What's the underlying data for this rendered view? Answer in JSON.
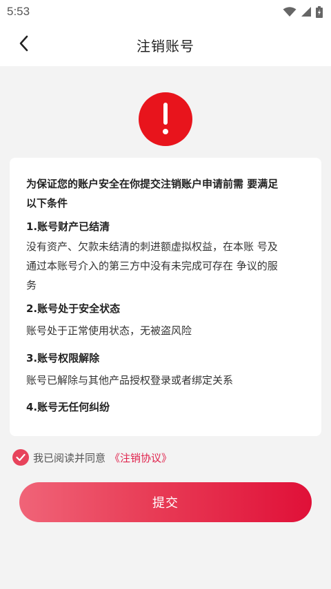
{
  "status_bar": {
    "time": "5:53"
  },
  "header": {
    "title": "注销账号"
  },
  "card": {
    "intro_line1": "为保证您的账户安全在你提交注销账户申请前需 要满足",
    "intro_line2": "以下条件",
    "sections": [
      {
        "title": "1.账号财产已结清",
        "lines": [
          "没有资产、欠款未结清的刺进额虚拟权益，在本账 号及",
          "通过本账号介入的第三方中没有未完成可存在 争议的服",
          "务"
        ]
      },
      {
        "title": "2.账号处于安全状态",
        "lines": [
          "账号处于正常使用状态，无被盗风险"
        ]
      },
      {
        "title": "3.账号权限解除",
        "lines": [
          "账号已解除与其他产品授权登录或者绑定关系"
        ]
      },
      {
        "title": "4.账号无任何纠纷",
        "lines": []
      }
    ]
  },
  "agreement": {
    "checked": true,
    "text": "我已阅读并同意",
    "link": "《注销协议》"
  },
  "submit_label": "提交",
  "colors": {
    "accent": "#e0224c",
    "alert": "#e8141c"
  },
  "icons": [
    "wifi-icon",
    "cell-signal-icon",
    "battery-icon",
    "back-arrow-icon",
    "exclamation-icon",
    "checkmark-icon"
  ]
}
